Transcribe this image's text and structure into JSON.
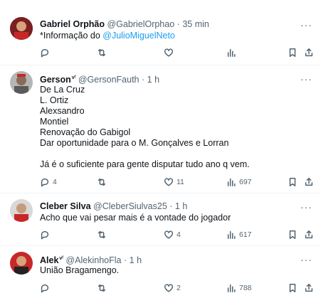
{
  "tweets": [
    {
      "name": "Gabriel Orphão",
      "handle": "@GabrielOrphao",
      "dot": "·",
      "time": "35 min",
      "text_prefix": "*Informação do ",
      "mention": "@JulioMiguelNeto",
      "actions": {
        "reply": "",
        "retweet": "",
        "like": "",
        "views": ""
      }
    },
    {
      "name": "Gerson",
      "verified": "ᴠᶠ",
      "handle": "@GersonFauth",
      "dot": "·",
      "time": "1 h",
      "lines": [
        "De La Cruz",
        "L. Ortiz",
        "Alexsandro",
        "Montiel",
        "Renovação do Gabigol",
        "Dar oportunidade para o M. Gonçalves e Lorran",
        "",
        "Já é o suficiente para gente disputar tudo ano q vem."
      ],
      "actions": {
        "reply": "4",
        "retweet": "",
        "like": "11",
        "views": "697"
      }
    },
    {
      "name": "Cleber Silva",
      "handle": "@CleberSiulvas25",
      "dot": "·",
      "time": "1 h",
      "text": "Acho que vai pesar mais é a vontade do jogador",
      "actions": {
        "reply": "",
        "retweet": "",
        "like": "4",
        "views": "617"
      }
    },
    {
      "name": "Alek",
      "verified": "ᴠᶠ",
      "handle": "@AlekinhoFla",
      "dot": "·",
      "time": "1 h",
      "text": "União Bragamengo.",
      "actions": {
        "reply": "",
        "retweet": "",
        "like": "2",
        "views": "788"
      }
    }
  ],
  "more_label": "···",
  "colors": {
    "accent": "#1d9bf0",
    "secondary": "#536471",
    "text": "#0f1419",
    "divider": "#eff3f4"
  },
  "icons": [
    "reply-icon",
    "retweet-icon",
    "like-icon",
    "views-icon",
    "bookmark-icon",
    "share-icon",
    "more-icon"
  ]
}
